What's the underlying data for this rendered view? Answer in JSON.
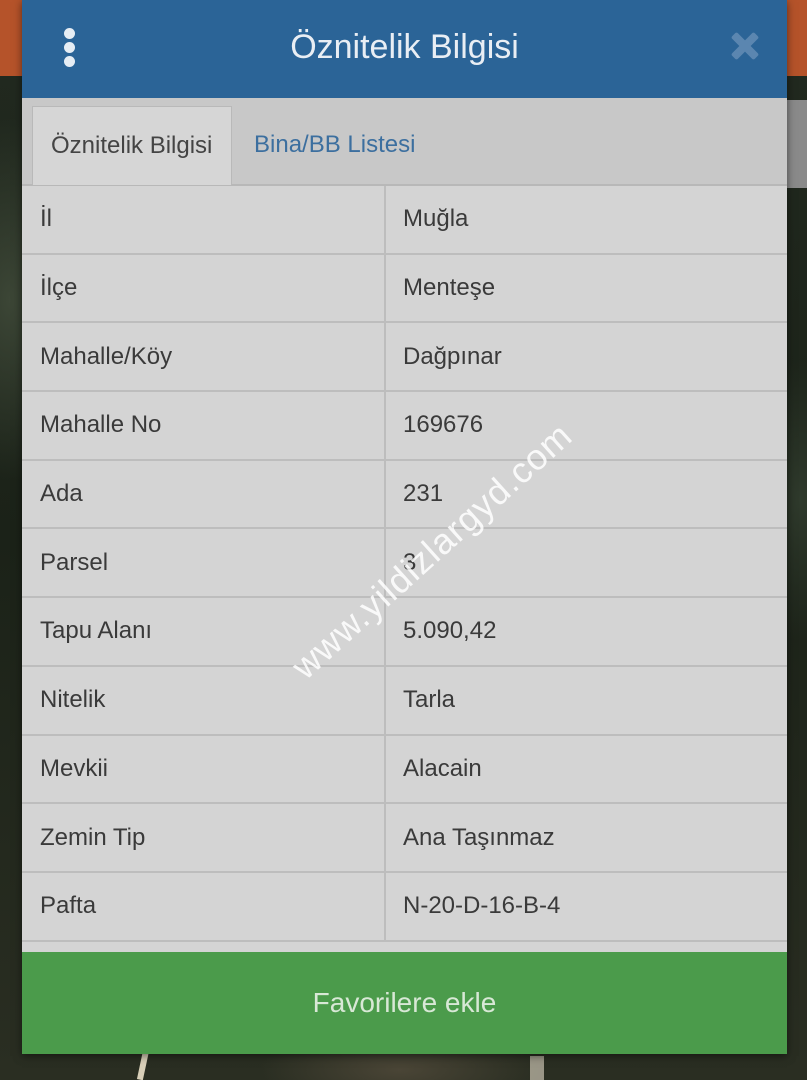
{
  "header": {
    "title": "Öznitelik Bilgisi",
    "menu_icon": "more-vertical-icon",
    "close_icon": "close-icon"
  },
  "tabs": [
    {
      "label": "Öznitelik Bilgisi",
      "active": true
    },
    {
      "label": "Bina/BB Listesi",
      "active": false
    }
  ],
  "rows": [
    {
      "label": "İl",
      "value": "Muğla"
    },
    {
      "label": "İlçe",
      "value": "Menteşe"
    },
    {
      "label": "Mahalle/Köy",
      "value": "Dağpınar"
    },
    {
      "label": "Mahalle No",
      "value": "169676"
    },
    {
      "label": "Ada",
      "value": "231"
    },
    {
      "label": "Parsel",
      "value": "3"
    },
    {
      "label": "Tapu Alanı",
      "value": "5.090,42"
    },
    {
      "label": "Nitelik",
      "value": "Tarla"
    },
    {
      "label": "Mevkii",
      "value": "Alacain"
    },
    {
      "label": "Zemin Tip",
      "value": "Ana Taşınmaz"
    },
    {
      "label": "Pafta",
      "value": "N-20-D-16-B-4"
    }
  ],
  "watermark": "www.yildizlargyd.com",
  "footer": {
    "button_label": "Favorilere ekle"
  },
  "colors": {
    "header": "#2b6497",
    "button": "#4b9b4b",
    "tab_link": "#3c6f9f"
  }
}
